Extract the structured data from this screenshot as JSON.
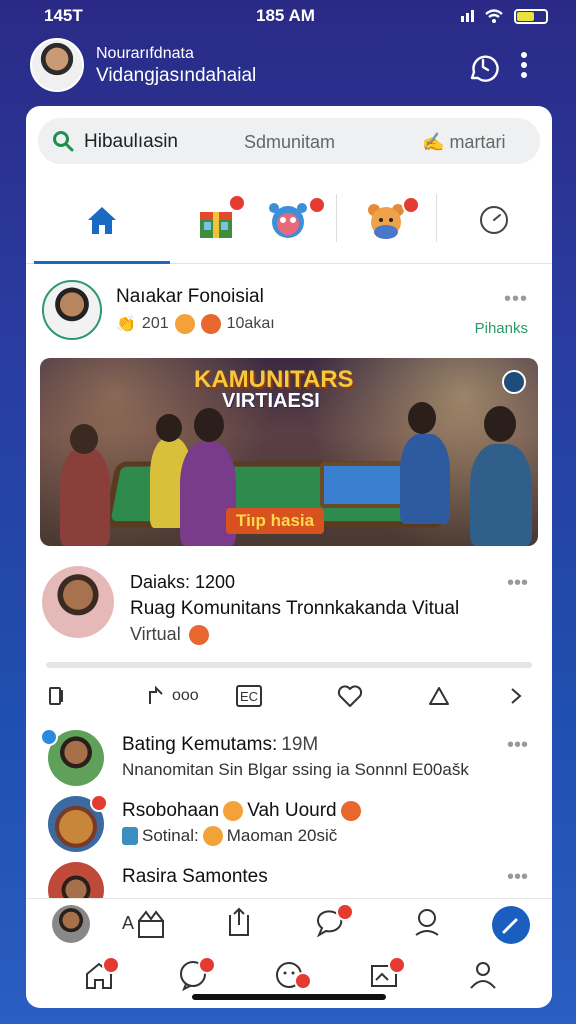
{
  "status": {
    "time_left": "145T",
    "time_center": "185 AM"
  },
  "header": {
    "line1": "Nourarıfdnata",
    "line2": "Vidangjasındahaial"
  },
  "search": {
    "value": "Hibaulıasin",
    "chip2": "Sdmunitam",
    "chip3": "martari"
  },
  "post": {
    "author": "Naıakar Fonoisial",
    "meta_count": "201",
    "meta_tag": "10akaı",
    "right_tag": "Pihanks",
    "banner_title": "KAMUNITARS",
    "banner_subtitle": "VIRTIAESI",
    "banner_pill": "Tiıp hasia"
  },
  "post2": {
    "line1": "Daiaks: 1200",
    "line2": "Ruag Komunitans Tronnkakanda Vitual",
    "line3": "Virtual"
  },
  "actions": {
    "reply_count": "ooo",
    "ec": "EC"
  },
  "list": [
    {
      "title": "Bating Kemutams:",
      "count": "19M",
      "sub": "Nnanomitan Sin Blgar ssing  ia Sonnnl E00ašk"
    },
    {
      "title": "Rsobohaan",
      "title2": "Vah Uourd",
      "sub": "Sotinal:",
      "sub2": "Maoman 20sič"
    },
    {
      "title": "Rasira Samontes"
    }
  ],
  "nav": {
    "item2_label": "A"
  },
  "colors": {
    "accent": "#1a6ac4",
    "badge": "#e53a2f",
    "green": "#2c9a6a"
  }
}
